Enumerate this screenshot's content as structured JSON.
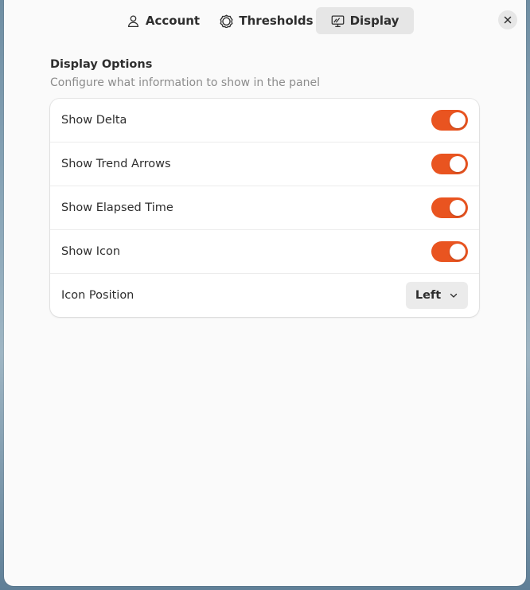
{
  "tabs": [
    {
      "label": "Account",
      "icon": "person-icon",
      "active": false
    },
    {
      "label": "Thresholds",
      "icon": "gauge-icon",
      "active": false
    },
    {
      "label": "Display",
      "icon": "monitor-icon",
      "active": true
    }
  ],
  "section": {
    "title": "Display Options",
    "subtitle": "Configure what information to show in the panel"
  },
  "settings": [
    {
      "label": "Show Delta",
      "type": "switch",
      "value": true
    },
    {
      "label": "Show Trend Arrows",
      "type": "switch",
      "value": true
    },
    {
      "label": "Show Elapsed Time",
      "type": "switch",
      "value": true
    },
    {
      "label": "Show Icon",
      "type": "switch",
      "value": true
    },
    {
      "label": "Icon Position",
      "type": "dropdown",
      "value": "Left"
    }
  ],
  "colors": {
    "accent": "#e95420",
    "window_bg": "#fafafa",
    "active_tab_bg": "#e6e6e6"
  }
}
